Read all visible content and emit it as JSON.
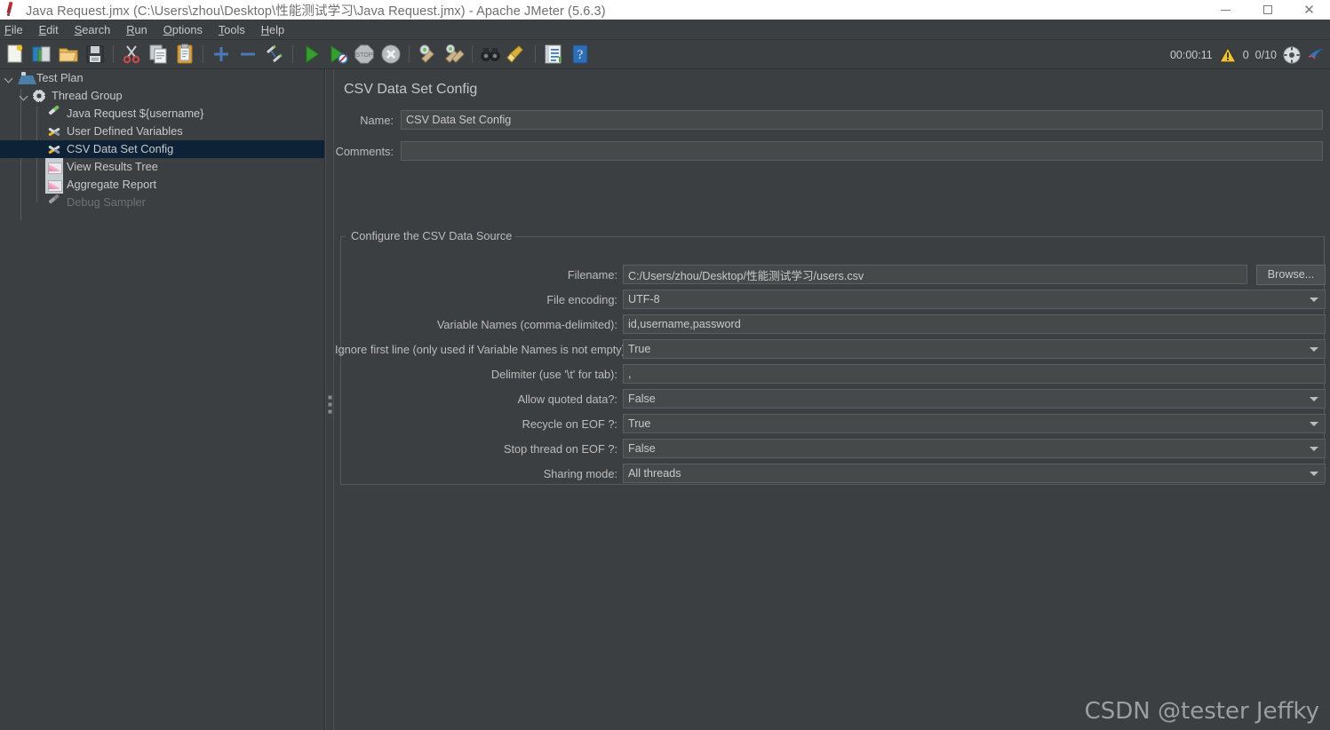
{
  "window": {
    "title": "Java Request.jmx (C:\\Users\\zhou\\Desktop\\性能测试学习\\Java Request.jmx) - Apache JMeter (5.6.3)",
    "app_icon": "jmeter-feather-icon",
    "minimize_label": "—",
    "maximize_label": "",
    "close_label": "✕"
  },
  "menubar": {
    "items": [
      {
        "label": "File",
        "mnemonic": "F"
      },
      {
        "label": "Edit",
        "mnemonic": "E"
      },
      {
        "label": "Search",
        "mnemonic": "S"
      },
      {
        "label": "Run",
        "mnemonic": "R"
      },
      {
        "label": "Options",
        "mnemonic": "O"
      },
      {
        "label": "Tools",
        "mnemonic": "T"
      },
      {
        "label": "Help",
        "mnemonic": "H"
      }
    ]
  },
  "toolbar": {
    "icons": [
      "new-test-plan-icon",
      "templates-icon",
      "open-icon",
      "save-icon",
      "sep",
      "cut-icon",
      "copy-icon",
      "paste-icon",
      "sep",
      "expand-icon",
      "collapse-icon",
      "toggle-icon",
      "sep",
      "start-icon",
      "start-no-pauses-icon",
      "stop-icon",
      "shutdown-icon",
      "sep",
      "clear-icon",
      "clear-all-icon",
      "sep",
      "search-icon",
      "reset-search-icon",
      "sep",
      "function-helper-icon",
      "help-icon"
    ],
    "elapsed_time": "00:00:11",
    "warning_icon": "warning-triangle-icon",
    "warning_count": "0",
    "thread_counter": "0/10",
    "remote_icon": "remote-start-icon",
    "stop_remote_icon": "stop-remote-icon"
  },
  "tree": {
    "items": [
      {
        "label": "Test Plan",
        "icon": "test-plan-icon",
        "indent": 0,
        "twisty": "open",
        "selected": false,
        "disabled": false
      },
      {
        "label": "Thread Group",
        "icon": "thread-group-icon",
        "indent": 1,
        "twisty": "open",
        "selected": false,
        "disabled": false
      },
      {
        "label": "Java Request ${username}",
        "icon": "java-request-icon",
        "indent": 2,
        "twisty": "none",
        "selected": false,
        "disabled": false
      },
      {
        "label": "User Defined Variables",
        "icon": "config-element-icon",
        "indent": 2,
        "twisty": "none",
        "selected": false,
        "disabled": false
      },
      {
        "label": "CSV Data Set Config",
        "icon": "config-element-icon",
        "indent": 2,
        "twisty": "none",
        "selected": true,
        "disabled": false
      },
      {
        "label": "View Results Tree",
        "icon": "listener-icon",
        "indent": 2,
        "twisty": "none",
        "selected": false,
        "disabled": false
      },
      {
        "label": "Aggregate Report",
        "icon": "listener-icon",
        "indent": 2,
        "twisty": "none",
        "selected": false,
        "disabled": false
      },
      {
        "label": "Debug Sampler",
        "icon": "java-request-icon",
        "indent": 2,
        "twisty": "none",
        "selected": false,
        "disabled": true
      }
    ]
  },
  "form": {
    "title": "CSV Data Set Config",
    "name_label": "Name:",
    "name_value": "CSV Data Set Config",
    "comments_label": "Comments:",
    "comments_value": "",
    "comments_placeholder": "",
    "group_title": "Configure the CSV Data Source",
    "browse_button": "Browse...",
    "fields": [
      {
        "label": "Filename:",
        "value": "C:/Users/zhou/Desktop/性能测试学习/users.csv",
        "type": "text"
      },
      {
        "label": "File encoding:",
        "value": "UTF-8",
        "type": "combo"
      },
      {
        "label": "Variable Names (comma-delimited):",
        "value": "id,username,password",
        "type": "text"
      },
      {
        "label": "Ignore first line (only used if Variable Names is not empty):",
        "value": "True",
        "type": "combo"
      },
      {
        "label": "Delimiter (use '\\t' for tab):",
        "value": ",",
        "type": "text"
      },
      {
        "label": "Allow quoted data?:",
        "value": "False",
        "type": "combo"
      },
      {
        "label": "Recycle on EOF ?:",
        "value": "True",
        "type": "combo"
      },
      {
        "label": "Stop thread on EOF ?:",
        "value": "False",
        "type": "combo"
      },
      {
        "label": "Sharing mode:",
        "value": "All threads",
        "type": "combo"
      }
    ]
  },
  "watermark": {
    "text": "CSDN @tester Jeffky"
  },
  "colors": {
    "background": "#3c3f41",
    "field_background": "#45494a",
    "selection": "#0d2236",
    "text": "#c8c8c8",
    "titlebar": "#ffffff",
    "accent_green": "#6fbf5c"
  }
}
